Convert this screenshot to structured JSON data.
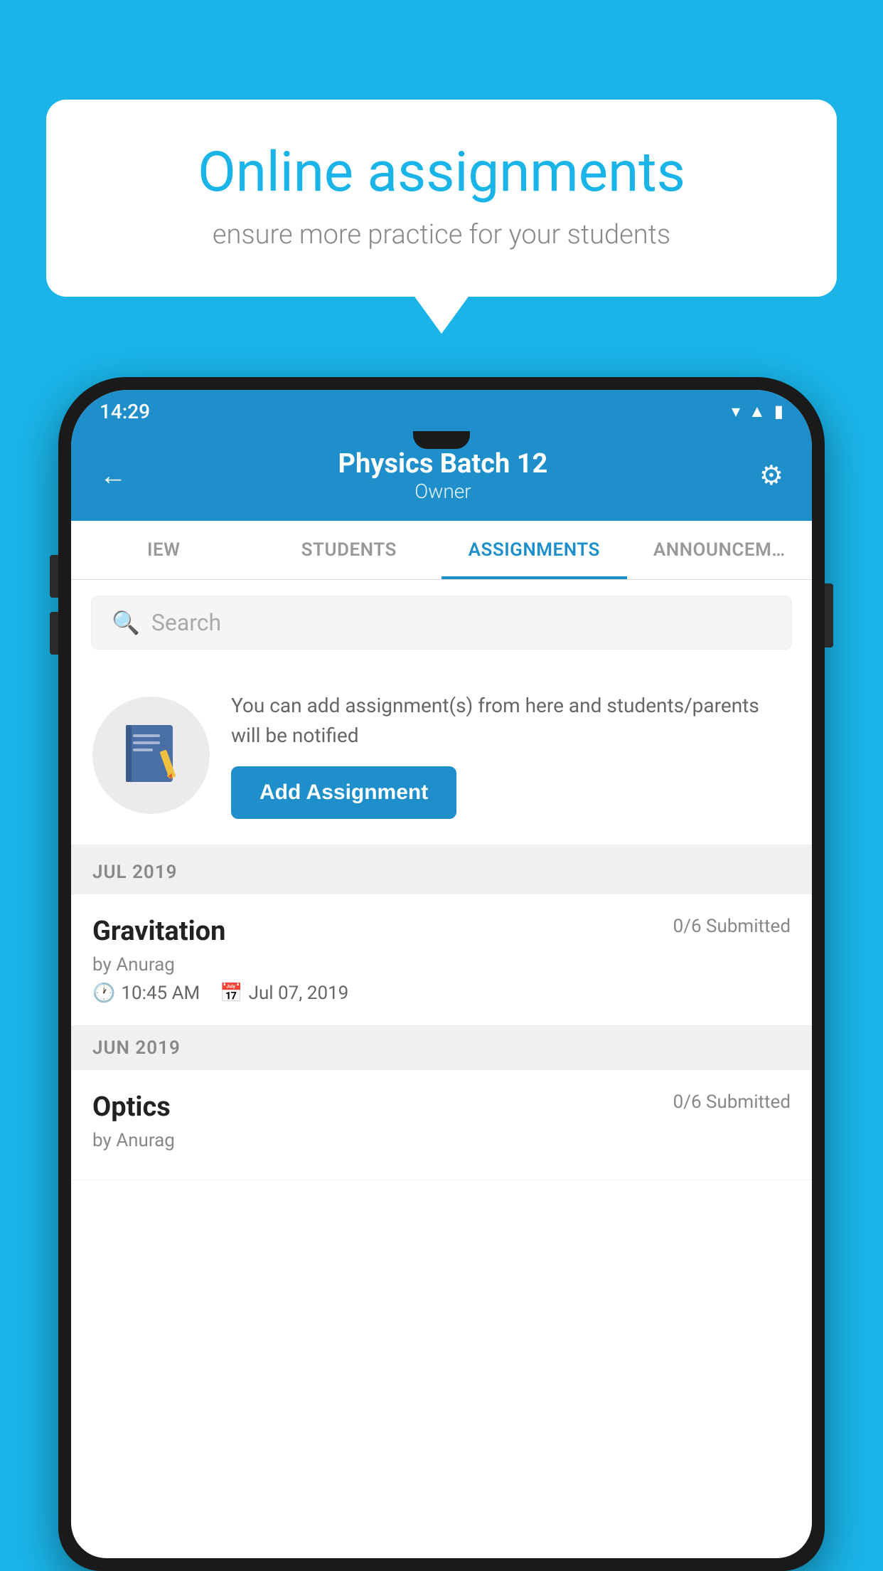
{
  "background_color": "#1ab4e8",
  "speech_bubble": {
    "title": "Online assignments",
    "subtitle": "ensure more practice for your students"
  },
  "status_bar": {
    "time": "14:29",
    "icons": [
      "wifi",
      "signal",
      "battery"
    ]
  },
  "header": {
    "title": "Physics Batch 12",
    "subtitle": "Owner",
    "back_label": "←",
    "settings_label": "⚙"
  },
  "tabs": [
    {
      "label": "IEW",
      "active": false
    },
    {
      "label": "STUDENTS",
      "active": false
    },
    {
      "label": "ASSIGNMENTS",
      "active": true
    },
    {
      "label": "ANNOUNCEMENTS",
      "active": false
    }
  ],
  "search": {
    "placeholder": "Search"
  },
  "promo": {
    "text": "You can add assignment(s) from here and students/parents will be notified",
    "button_label": "Add Assignment"
  },
  "sections": [
    {
      "month": "JUL 2019",
      "assignments": [
        {
          "name": "Gravitation",
          "submitted": "0/6 Submitted",
          "by": "by Anurag",
          "time": "10:45 AM",
          "date": "Jul 07, 2019"
        }
      ]
    },
    {
      "month": "JUN 2019",
      "assignments": [
        {
          "name": "Optics",
          "submitted": "0/6 Submitted",
          "by": "by Anurag",
          "time": "",
          "date": ""
        }
      ]
    }
  ]
}
